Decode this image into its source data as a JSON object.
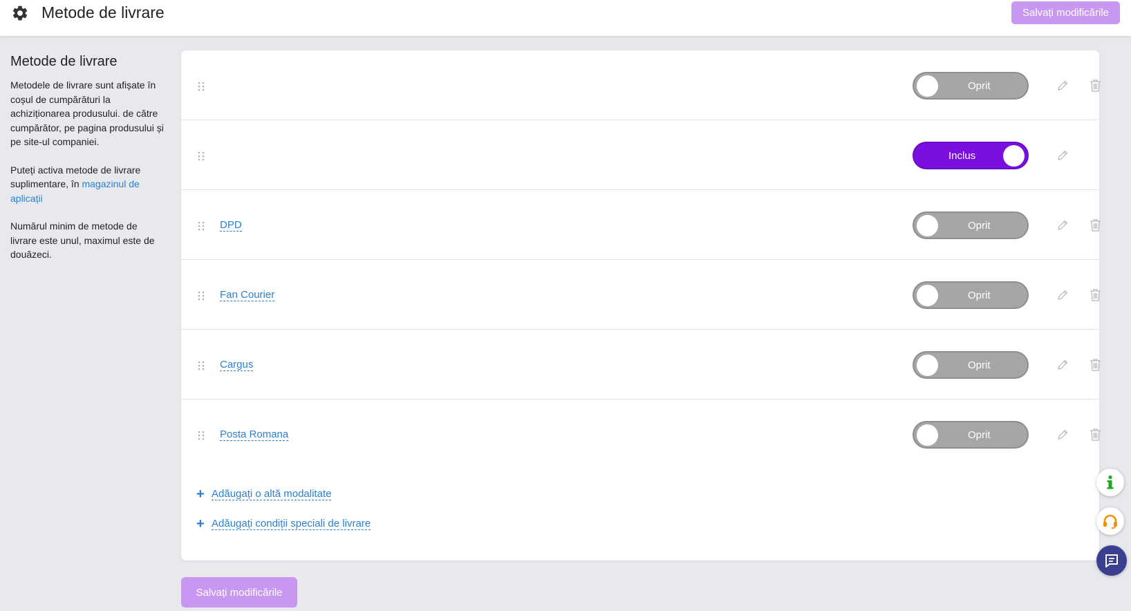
{
  "header": {
    "title": "Metode de livrare",
    "save_label": "Salvați modificările"
  },
  "sidebar": {
    "title": "Metode de livrare",
    "paragraph1": "Metodele de livrare sunt afișate în coșul de cumpărături la achiziționarea produsului. de către cumpărător, pe pagina produsului și pe site-ul companiei.",
    "paragraph2_text": "Puteți activa metode de livrare suplimentare, în ",
    "paragraph2_link": "magazinul de aplicații",
    "paragraph3": "Numărul minim de metode de livrare este unul, maximul este de douăzeci."
  },
  "methods": [
    {
      "name": "",
      "status": "Oprit",
      "enabled": false,
      "deletable": true
    },
    {
      "name": "",
      "status": "Inclus",
      "enabled": true,
      "deletable": false
    },
    {
      "name": "DPD",
      "status": "Oprit",
      "enabled": false,
      "deletable": true
    },
    {
      "name": "Fan Courier",
      "status": "Oprit",
      "enabled": false,
      "deletable": true
    },
    {
      "name": "Cargus",
      "status": "Oprit",
      "enabled": false,
      "deletable": true
    },
    {
      "name": "Posta Romana",
      "status": "Oprit",
      "enabled": false,
      "deletable": true
    }
  ],
  "actions": {
    "add_method": "Adăugați o altă modalitate",
    "add_conditions": "Adăugați condiții speciali de livrare"
  },
  "footer": {
    "save_label": "Salvați modificările"
  },
  "colors": {
    "accent": "#7a0fe0",
    "save_button": "#c897f2",
    "link": "#2a7fd4",
    "toggle_off": "#a6a6a6"
  }
}
